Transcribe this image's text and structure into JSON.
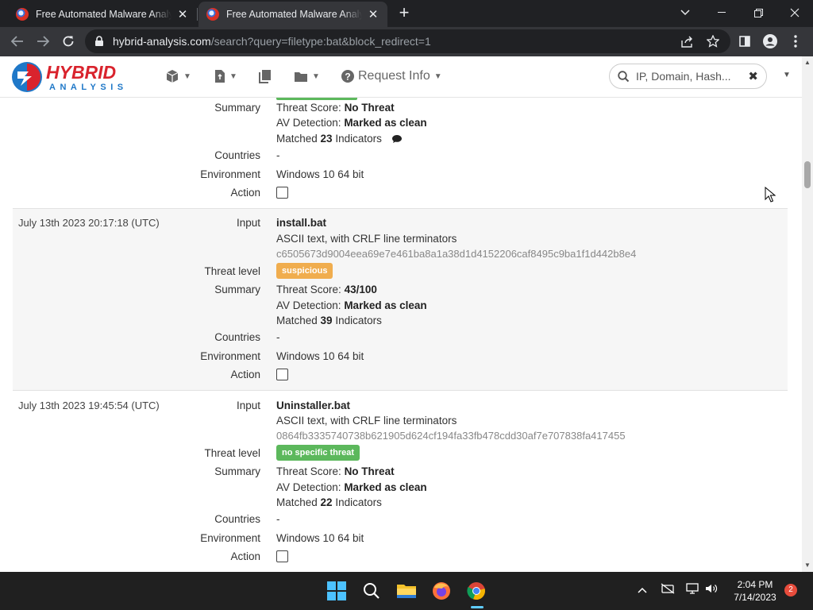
{
  "browser": {
    "tabs": [
      {
        "title": "Free Automated Malware Analysis Service",
        "active": false
      },
      {
        "title": "Free Automated Malware Analysis Service",
        "active": true
      }
    ],
    "url_host": "hybrid-analysis.com",
    "url_path": "/search?query=filetype:bat&block_redirect=1"
  },
  "site": {
    "logo_top": "HYBRID",
    "logo_bottom": "ANALYSIS",
    "nav": {
      "request_info": "Request Info"
    },
    "search_placeholder": "IP, Domain, Hash..."
  },
  "labels": {
    "input": "Input",
    "threat_level": "Threat level",
    "summary": "Summary",
    "countries": "Countries",
    "environment": "Environment",
    "action": "Action"
  },
  "results": [
    {
      "summary": {
        "score_label": "Threat Score:",
        "score": "No Threat",
        "av_label": "AV Detection:",
        "av": "Marked as clean",
        "matched_pre": "Matched",
        "matched_count": "23",
        "matched_post": "Indicators"
      },
      "countries": "-",
      "environment": "Windows 10 64 bit"
    },
    {
      "date": "July 13th 2023 20:17:18 (UTC)",
      "filename": "install.bat",
      "filetype": "ASCII text, with CRLF line terminators",
      "hash": "c6505673d9004eea69e7e461ba8a1a38d1d4152206caf8495c9ba1f1d442b8e4",
      "threat_level": "suspicious",
      "threat_color": "#f0ad4e",
      "summary": {
        "score_label": "Threat Score:",
        "score": "43/100",
        "av_label": "AV Detection:",
        "av": "Marked as clean",
        "matched_pre": "Matched",
        "matched_count": "39",
        "matched_post": "Indicators"
      },
      "countries": "-",
      "environment": "Windows 10 64 bit"
    },
    {
      "date": "July 13th 2023 19:45:54 (UTC)",
      "filename": "Uninstaller.bat",
      "filetype": "ASCII text, with CRLF line terminators",
      "hash": "0864fb3335740738b621905d624cf194fa33fb478cdd30af7e707838fa417455",
      "threat_level": "no specific threat",
      "threat_color": "#5cb85c",
      "summary": {
        "score_label": "Threat Score:",
        "score": "No Threat",
        "av_label": "AV Detection:",
        "av": "Marked as clean",
        "matched_pre": "Matched",
        "matched_count": "22",
        "matched_post": "Indicators"
      },
      "countries": "-",
      "environment": "Windows 10 64 bit"
    }
  ],
  "taskbar": {
    "time": "2:04 PM",
    "date": "7/14/2023",
    "notifications": "2"
  }
}
